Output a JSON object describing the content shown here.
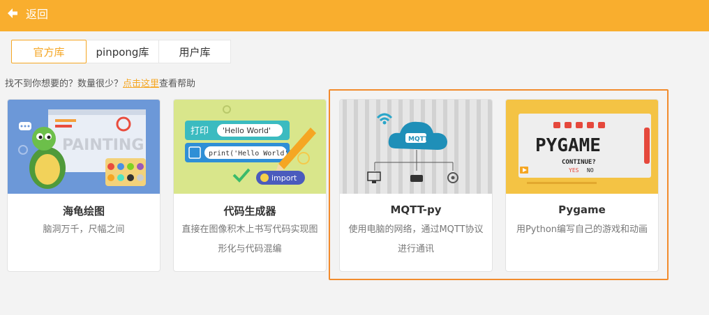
{
  "header": {
    "back_label": "返回"
  },
  "tabs": [
    {
      "label": "官方库"
    },
    {
      "label": "pinpong库"
    },
    {
      "label": "用户库"
    }
  ],
  "help": {
    "prefix": "找不到你想要的？数量很少？",
    "link": "点击这里",
    "suffix": "查看帮助"
  },
  "cards": [
    {
      "title": "海龟绘图",
      "desc": "脑洞万千，尺幅之间",
      "thumb_text": "PAINTING"
    },
    {
      "title": "代码生成器",
      "desc": "直接在图像积木上书写代码实现图形化与代码混编",
      "thumb_print_cn": "打印",
      "thumb_hello": "'Hello World'",
      "thumb_print_code": "print('Hello World')",
      "thumb_import": "import"
    },
    {
      "title": "MQTT-py",
      "desc": "使用电脑的网络，通过MQTT协议进行通讯",
      "thumb_cloud": "MQTT"
    },
    {
      "title": "Pygame",
      "desc": "用Python编写自己的游戏和动画",
      "thumb_logo": "PYGAME",
      "thumb_continue": "CONTINUE?",
      "thumb_yes": "YES",
      "thumb_no": "NO"
    }
  ],
  "colors": {
    "accent": "#f9ae2e",
    "highlight": "#f28b2c",
    "link": "#f5a623"
  },
  "icons": [
    "back-arrow-icon"
  ]
}
